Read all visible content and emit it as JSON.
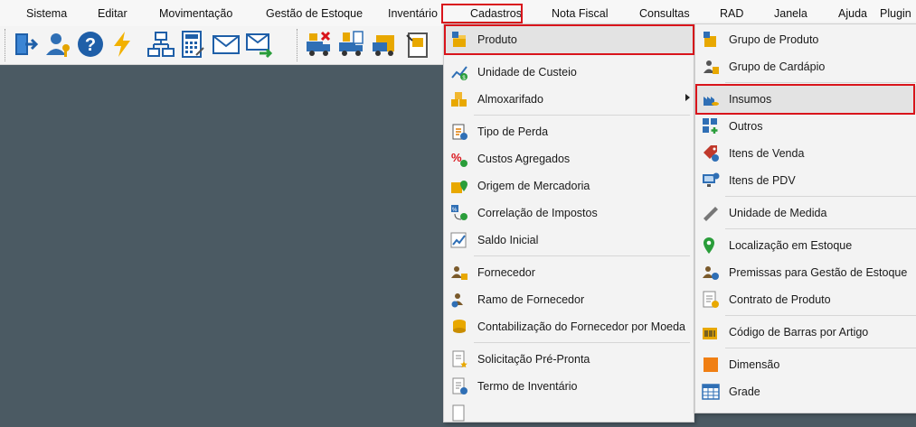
{
  "menubar": {
    "items": [
      "Sistema",
      "Editar",
      "Movimentação",
      "Gestão de Estoque",
      "Inventário",
      "Cadastros",
      "Nota Fiscal",
      "Consultas",
      "RAD",
      "Janela",
      "Ajuda",
      "Plugin"
    ]
  },
  "toolbar": {
    "buttons": [
      {
        "icon": "exit-icon"
      },
      {
        "icon": "user-key-icon"
      },
      {
        "icon": "help-icon"
      },
      {
        "icon": "lightning-icon"
      },
      {
        "icon": "org-chart-icon"
      },
      {
        "icon": "calculator-icon"
      },
      {
        "icon": "mail-icon"
      },
      {
        "icon": "mail-forward-icon"
      },
      {
        "icon": "truck-remove-icon"
      },
      {
        "icon": "truck-document-icon"
      },
      {
        "icon": "truck-box-icon"
      },
      {
        "icon": "inventory-pad-icon"
      }
    ]
  },
  "cadastros_menu": {
    "items": [
      {
        "label": "Produto",
        "icon": "product-box-icon"
      },
      {
        "label": "Unidade de Custeio",
        "icon": "cost-chart-icon"
      },
      {
        "label": "Almoxarifado",
        "icon": "warehouse-boxes-icon",
        "submenu": true
      },
      {
        "label": "Tipo de Perda",
        "icon": "loss-clipboard-icon"
      },
      {
        "label": "Custos Agregados",
        "icon": "percent-cost-icon"
      },
      {
        "label": "Origem de Mercadoria",
        "icon": "origin-pin-icon"
      },
      {
        "label": "Correlação de Impostos",
        "icon": "tax-correlation-icon"
      },
      {
        "label": "Saldo Inicial",
        "icon": "initial-balance-icon"
      },
      {
        "label": "Fornecedor",
        "icon": "supplier-people-icon"
      },
      {
        "label": "Ramo de Fornecedor",
        "icon": "supplier-branch-icon"
      },
      {
        "label": "Contabilização do Fornecedor por Moeda",
        "icon": "coins-stack-icon"
      },
      {
        "label": "Solicitação Pré-Pronta",
        "icon": "request-document-icon"
      },
      {
        "label": "Termo de Inventário",
        "icon": "inventory-term-icon"
      },
      {
        "label": "",
        "icon": "partial-item-icon"
      }
    ]
  },
  "produto_submenu": {
    "items": [
      {
        "label": "Grupo de Produto",
        "icon": "product-group-icon"
      },
      {
        "label": "Grupo de Cardápio",
        "icon": "menu-group-icon"
      },
      {
        "label": "Insumos",
        "icon": "supplies-icon"
      },
      {
        "label": "Outros",
        "icon": "others-grid-icon"
      },
      {
        "label": "Itens de Venda",
        "icon": "sale-tag-icon"
      },
      {
        "label": "Itens de PDV",
        "icon": "pos-monitor-icon"
      },
      {
        "label": "Unidade de Medida",
        "icon": "ruler-icon"
      },
      {
        "label": "Localização em Estoque",
        "icon": "location-pin-icon"
      },
      {
        "label": "Premissas para Gestão de Estoque",
        "icon": "stock-premises-icon"
      },
      {
        "label": "Contrato de Produto",
        "icon": "contract-document-icon"
      },
      {
        "label": "Código de Barras por Artigo",
        "icon": "barcode-box-icon"
      },
      {
        "label": "Dimensão",
        "icon": "dimension-square-icon"
      },
      {
        "label": "Grade",
        "icon": "grid-table-icon"
      }
    ]
  },
  "colors": {
    "highlight": "#d9141b",
    "workspace": "#4b5a63",
    "menu_bg": "#f3f3f3"
  }
}
